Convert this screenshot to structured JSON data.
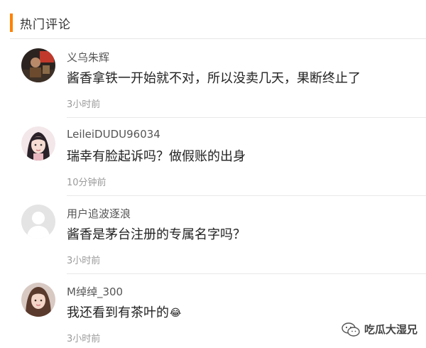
{
  "section": {
    "title": "热门评论",
    "accent_color": "#ff8200"
  },
  "comments": [
    {
      "username": "义乌朱辉",
      "text": "酱香拿铁一开始就不对，所以没卖几天，果断终止了",
      "time": "3小时前",
      "avatar": "photo-avatar-dark"
    },
    {
      "username": "LeileiDUDU96034",
      "text": "瑞幸有脸起诉吗？做假账的出身",
      "time": "10分钟前",
      "avatar": "illustrated-girl-avatar"
    },
    {
      "username": "用户追波逐浪",
      "text": "酱香是茅台注册的专属名字吗？",
      "time": "3小时前",
      "avatar": "default-user-avatar"
    },
    {
      "username": "M绰绰_300",
      "text": "我还看到有茶叶的",
      "emoji": "😂",
      "time": "3小时前",
      "avatar": "photo-avatar-woman"
    }
  ],
  "watermark": {
    "text": "吃瓜大湿兄",
    "icon": "wechat-icon"
  }
}
